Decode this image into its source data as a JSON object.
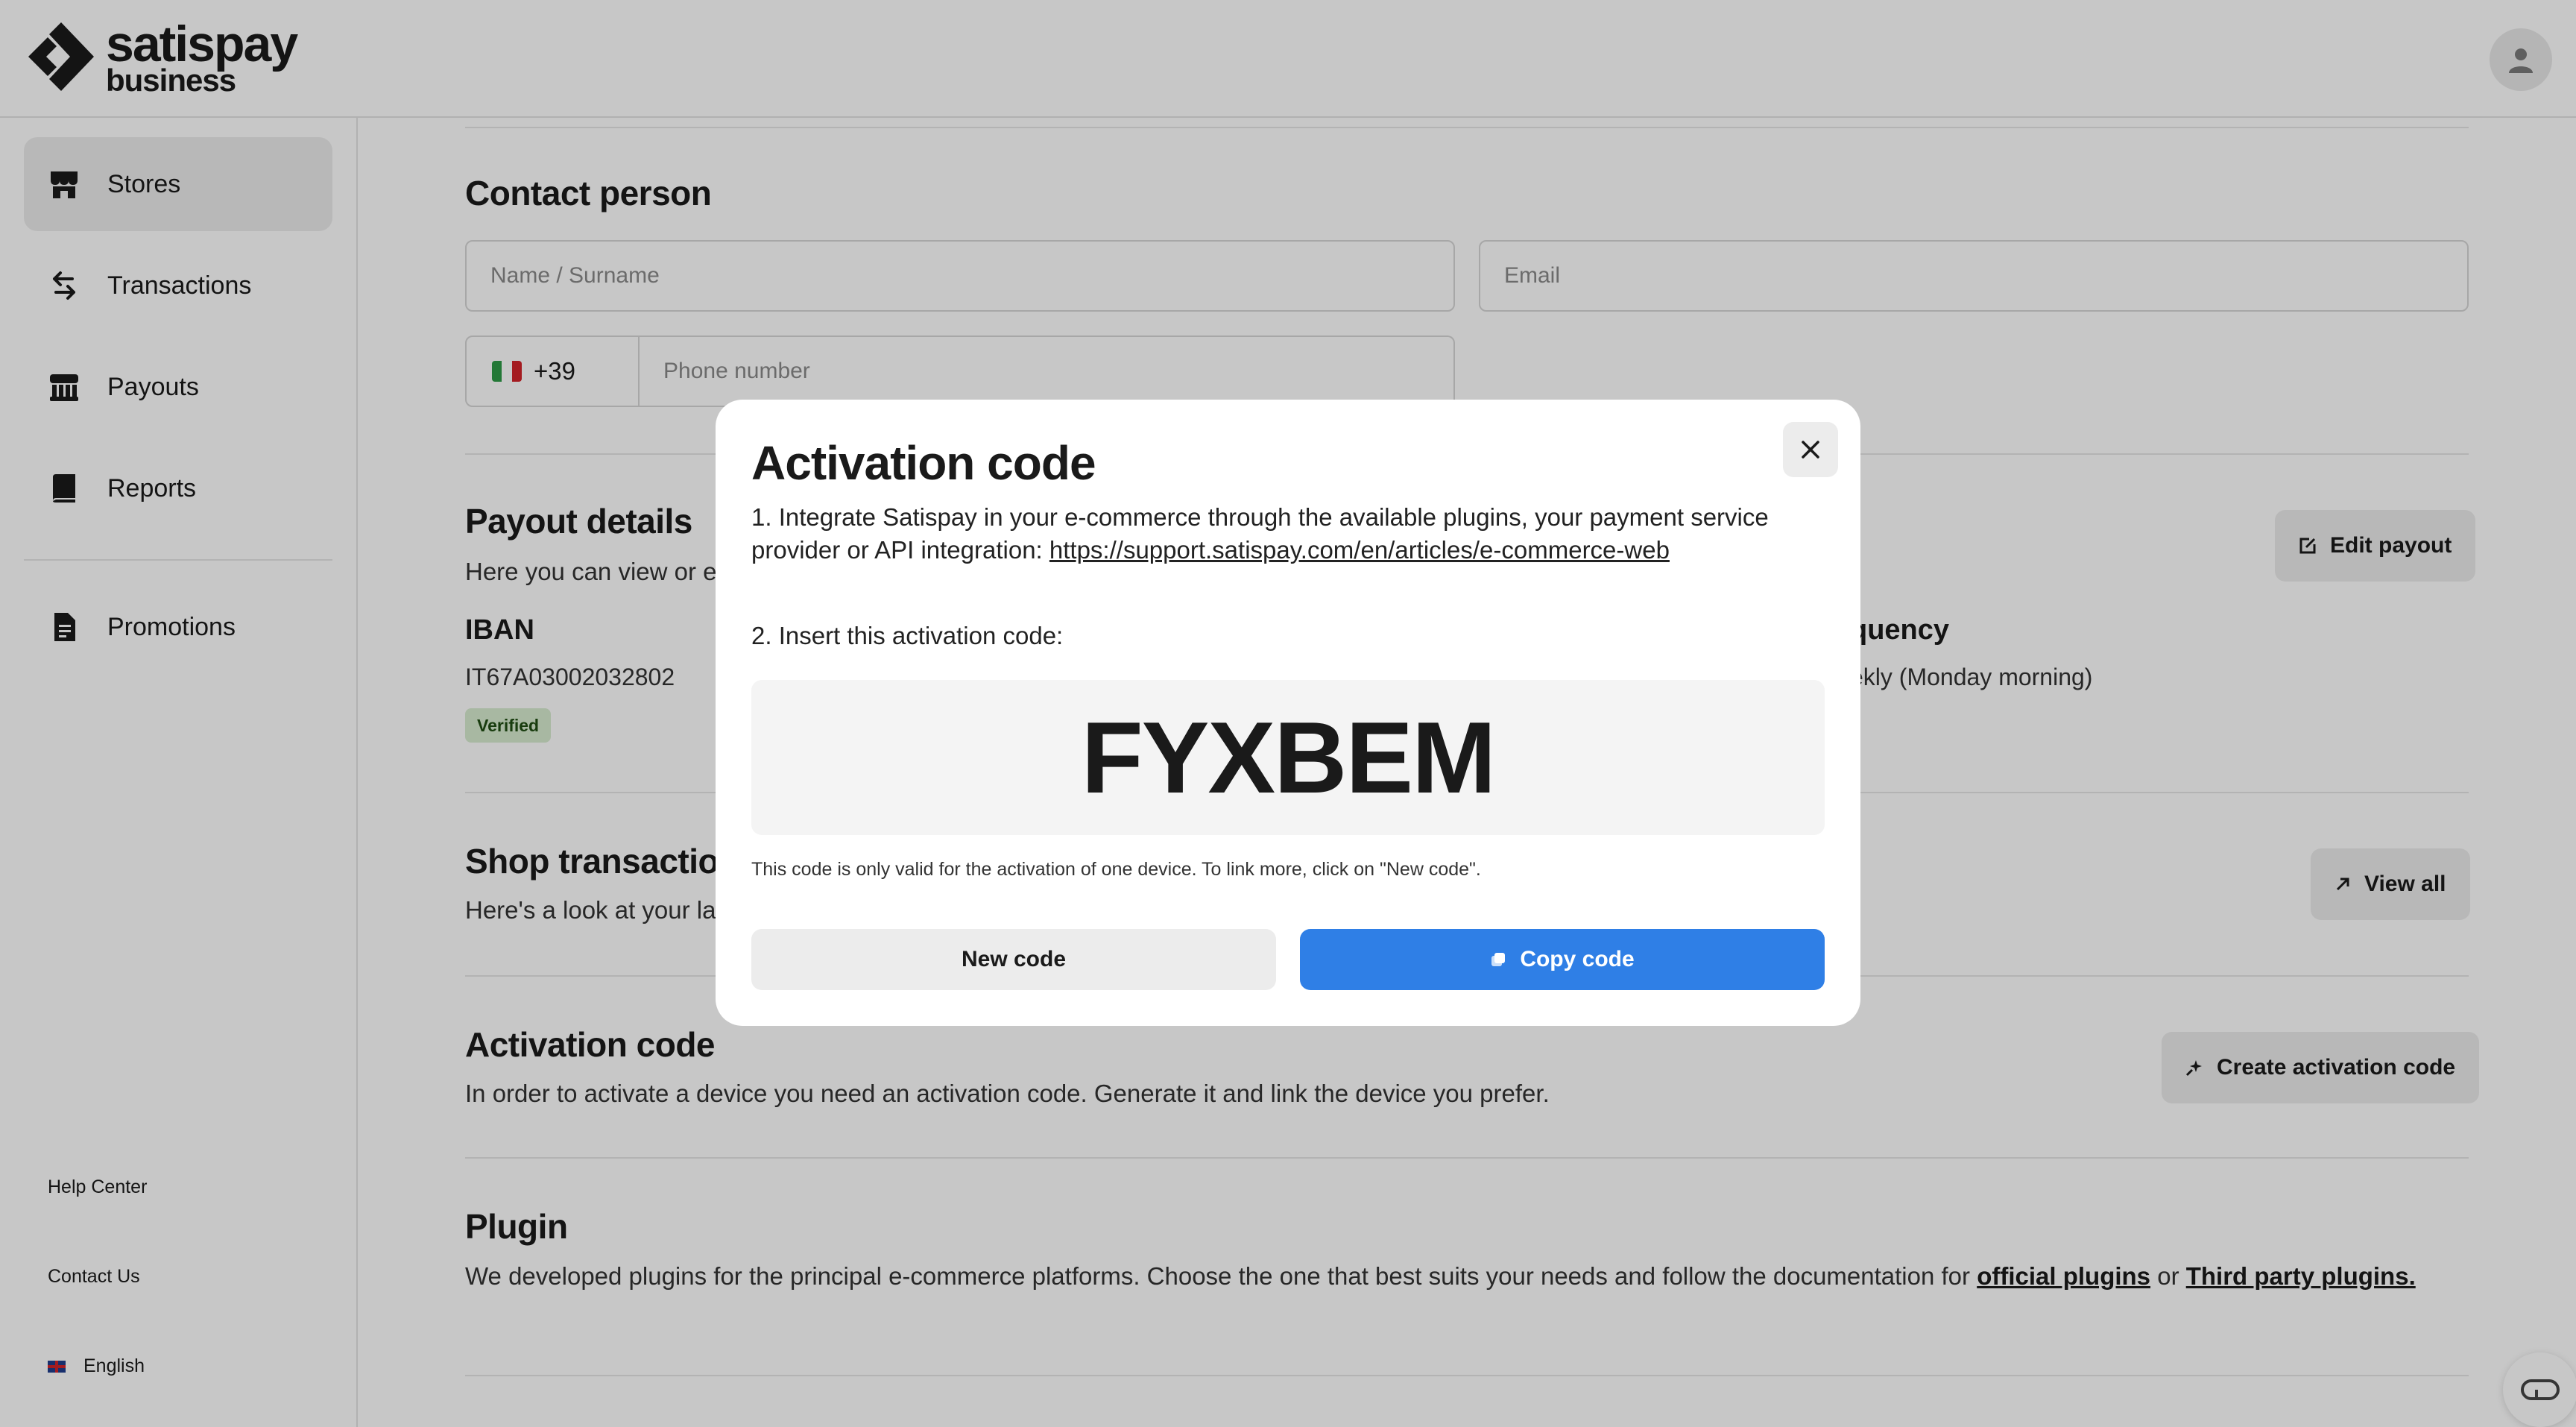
{
  "brand": {
    "line1": "satispay",
    "line2": "business"
  },
  "sidebar": {
    "items": [
      {
        "label": "Stores",
        "icon": "store-icon"
      },
      {
        "label": "Transactions",
        "icon": "arrows-swap-icon"
      },
      {
        "label": "Payouts",
        "icon": "bank-icon"
      },
      {
        "label": "Reports",
        "icon": "book-icon"
      },
      {
        "label": "Promotions",
        "icon": "document-icon"
      }
    ],
    "footer": {
      "help": "Help Center",
      "contact": "Contact Us",
      "language": "English"
    }
  },
  "contact": {
    "title": "Contact person",
    "name_placeholder": "Name / Surname",
    "email_placeholder": "Email",
    "phone_prefix": "+39",
    "phone_placeholder": "Phone number"
  },
  "payout": {
    "title": "Payout details",
    "subtitle": "Here you can view or e",
    "edit_label": "Edit payout",
    "iban_label": "IBAN",
    "iban_value": "IT67A03002032802",
    "verified_badge": "Verified",
    "frequency_label": "quency",
    "frequency_value": "ekly (Monday morning)"
  },
  "shop_transactions": {
    "title": "Shop transactio",
    "subtitle": "Here's a look at your la",
    "view_all_label": "View all"
  },
  "activation_section": {
    "title": "Activation code",
    "text": "In order to activate a device you need an activation code. Generate it and link the device you prefer.",
    "create_label": "Create activation code"
  },
  "plugin": {
    "title": "Plugin",
    "text": "We developed plugins for the principal e-commerce platforms. Choose the one that best suits your needs and follow the documentation for ",
    "link1": "official plugins",
    "or": " or ",
    "link2": "Third party plugins."
  },
  "modal": {
    "title": "Activation code",
    "step1_text": "1. Integrate Satispay in your e-commerce through the available plugins, your payment service provider or API integration: ",
    "step1_link": "https://support.satispay.com/en/articles/e-commerce-web",
    "step2_text": "2. Insert this activation code:",
    "code": "FYXBEM",
    "note": "This code is only valid for the activation of one device. To link more, click on \"New code\".",
    "new_code_label": "New code",
    "copy_code_label": "Copy code"
  },
  "colors": {
    "primary": "#2f7fe6",
    "badge_bg": "#d8ecd0",
    "overlay": "rgba(0,0,0,0.22)"
  }
}
